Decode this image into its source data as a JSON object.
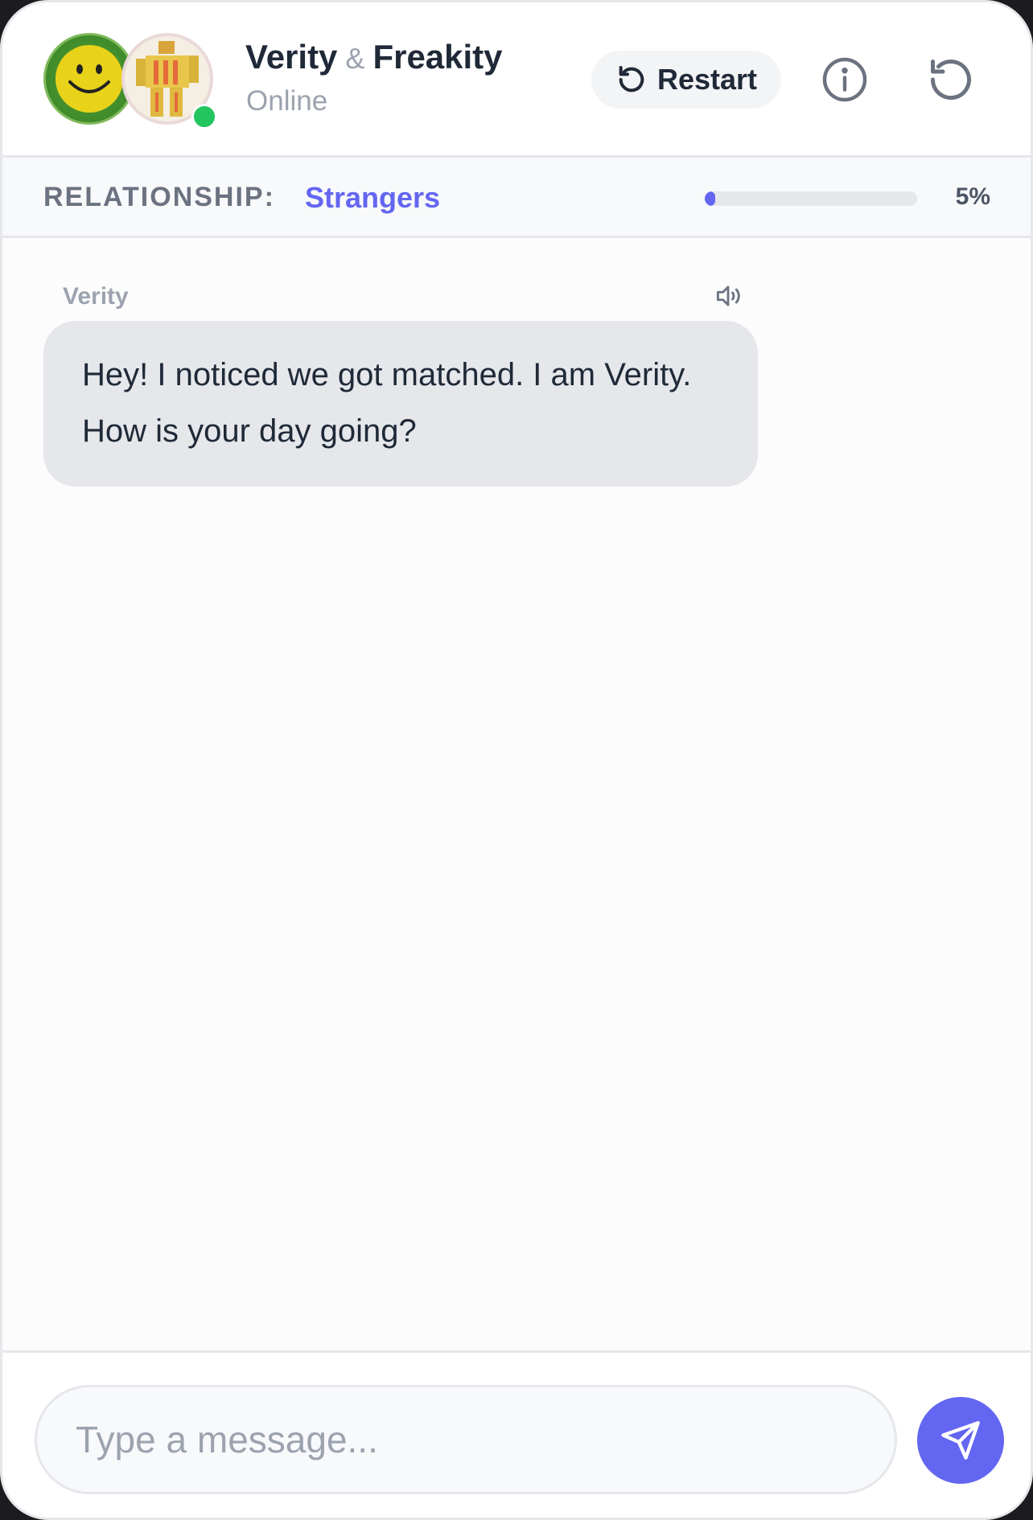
{
  "header": {
    "name_primary": "Verity",
    "ampersand": "&",
    "name_secondary": "Freakity",
    "status": "Online",
    "restart_label": "Restart",
    "avatars": [
      {
        "name": "verity-avatar",
        "icon": "smiley-face"
      },
      {
        "name": "freakity-avatar",
        "icon": "yellow-robot-figure"
      }
    ],
    "online_color": "#22c55e"
  },
  "relationship": {
    "label": "RELATIONSHIP:",
    "value": "Strangers",
    "progress_percent": 5,
    "progress_text": "5%",
    "accent_color": "#6366f1"
  },
  "messages": [
    {
      "sender": "Verity",
      "text": "Hey! I noticed we got matched. I am Verity. How is your day going?",
      "icon": "speaker-icon"
    }
  ],
  "composer": {
    "placeholder": "Type a message...",
    "send_icon": "send-icon"
  }
}
